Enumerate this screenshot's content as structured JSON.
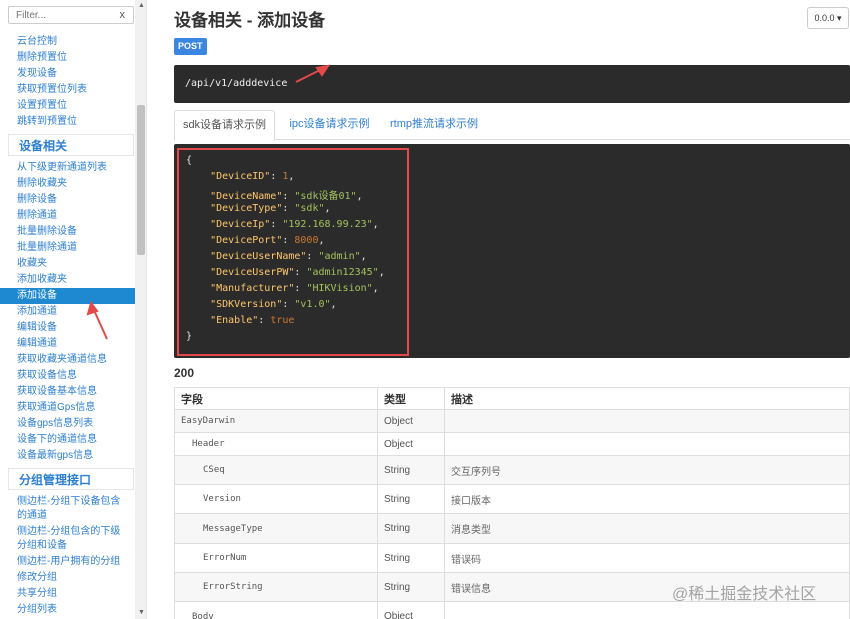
{
  "sidebar": {
    "filter_placeholder": "Filter...",
    "filter_clear": "x",
    "group1_items": [
      "云台控制",
      "删除预置位",
      "发现设备",
      "获取预置位列表",
      "设置预置位",
      "跳转到预置位"
    ],
    "group2_header": "设备相关",
    "group2_items": [
      "从下级更新通道列表",
      "删除收藏夹",
      "删除设备",
      "删除通道",
      "批量删除设备",
      "批量删除通道",
      "收藏夹",
      "添加收藏夹",
      "添加设备",
      "添加通道",
      "编辑设备",
      "编辑通道",
      "获取收藏夹通道信息",
      "获取设备信息",
      "获取设备基本信息",
      "获取通道Gps信息",
      "设备gps信息列表",
      "设备下的通道信息",
      "设备最新gps信息"
    ],
    "active_item": "添加设备",
    "group3_header": "分组管理接口",
    "group3_items": [
      "侧边栏-分组下设备包含的通道",
      "侧边栏-分组包含的下级分组和设备",
      "侧边栏-用户拥有的分组",
      "修改分组",
      "共享分组",
      "分组列表"
    ]
  },
  "main": {
    "title": "设备相关 - 添加设备",
    "version": "0.0.0 ▾",
    "method": "POST",
    "endpoint": "/api/v1/adddevice",
    "tabs": [
      "sdk设备请求示例",
      "ipc设备请求示例",
      "rtmp推流请求示例"
    ],
    "active_tab": "sdk设备请求示例",
    "code": {
      "open": "{",
      "close": "}",
      "fields": [
        {
          "key": "\"DeviceID\"",
          "value": "1",
          "type": "num"
        },
        {
          "key": "\"DeviceName\"",
          "value": "\"sdk设备01\"",
          "type": "str"
        },
        {
          "key": "\"DeviceType\"",
          "value": "\"sdk\"",
          "type": "str"
        },
        {
          "key": "\"DeviceIp\"",
          "value": "\"192.168.99.23\"",
          "type": "str"
        },
        {
          "key": "\"DevicePort\"",
          "value": "8000",
          "type": "num"
        },
        {
          "key": "\"DeviceUserName\"",
          "value": "\"admin\"",
          "type": "str"
        },
        {
          "key": "\"DeviceUserPW\"",
          "value": "\"admin12345\"",
          "type": "str"
        },
        {
          "key": "\"Manufacturer\"",
          "value": "\"HIKVision\"",
          "type": "str"
        },
        {
          "key": "\"SDKVersion\"",
          "value": "\"v1.0\"",
          "type": "str"
        },
        {
          "key": "\"Enable\"",
          "value": "true",
          "type": "num"
        }
      ]
    },
    "status_code": "200",
    "table": {
      "headers": [
        "字段",
        "类型",
        "描述"
      ],
      "rows": [
        {
          "field": "EasyDarwin",
          "level": 0,
          "type": "Object",
          "desc": ""
        },
        {
          "field": "Header",
          "level": 1,
          "type": "Object",
          "desc": ""
        },
        {
          "field": "CSeq",
          "level": 2,
          "type": "String",
          "desc": "交互序列号"
        },
        {
          "field": "Version",
          "level": 2,
          "type": "String",
          "desc": "接口版本"
        },
        {
          "field": "MessageType",
          "level": 2,
          "type": "String",
          "desc": "消息类型"
        },
        {
          "field": "ErrorNum",
          "level": 2,
          "type": "String",
          "desc": "错误码"
        },
        {
          "field": "ErrorString",
          "level": 2,
          "type": "String",
          "desc": "错误信息"
        },
        {
          "field": "Body",
          "level": 1,
          "type": "Object",
          "desc": ""
        }
      ]
    }
  },
  "watermark": "@稀土掘金技术社区",
  "colors": {
    "accent": "#1e88d1",
    "link": "#2f7fd0",
    "code_bg": "#2b2b2b",
    "highlight": "#e24a4a"
  }
}
